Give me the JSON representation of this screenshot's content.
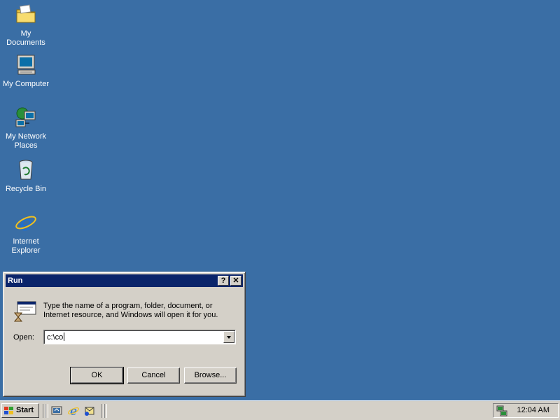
{
  "desktop": {
    "icons": [
      {
        "label_line1": "My Documents",
        "label_line2": ""
      },
      {
        "label_line1": "My Computer",
        "label_line2": ""
      },
      {
        "label_line1": "My Network",
        "label_line2": "Places"
      },
      {
        "label_line1": "Recycle Bin",
        "label_line2": ""
      },
      {
        "label_line1": "Internet",
        "label_line2": "Explorer"
      }
    ],
    "background_color": "#3a6ea5"
  },
  "run_dialog": {
    "title": "Run",
    "help_button": "?",
    "close_button": "✕",
    "description": "Type the name of a program, folder, document, or Internet resource, and Windows will open it for you.",
    "open_label": "Open:",
    "open_value": "c:\\co",
    "buttons": {
      "ok": "OK",
      "cancel": "Cancel",
      "browse": "Browse..."
    },
    "title_bar_color": "#0a246a"
  },
  "taskbar": {
    "start_label": "Start",
    "clock": "12:04 AM"
  }
}
